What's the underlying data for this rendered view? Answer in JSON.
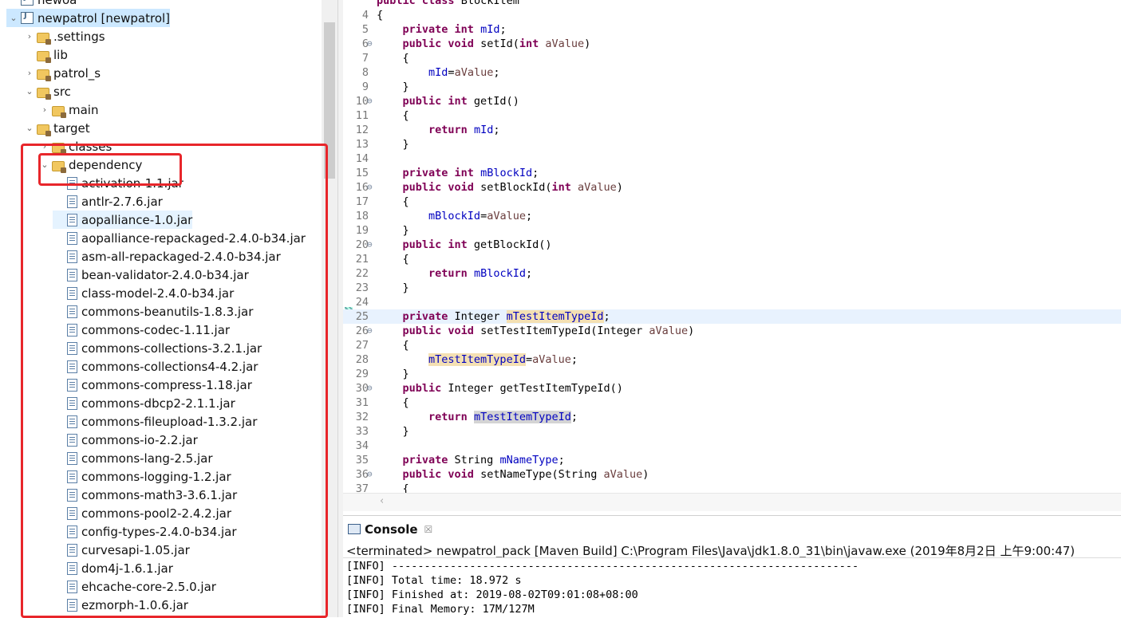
{
  "tree": {
    "rows": [
      {
        "label": "newoa",
        "level": 1,
        "icon": "project-icon",
        "chev": ""
      },
      {
        "label": "newpatrol [newpatrol]",
        "level": 1,
        "icon": "project-icon",
        "chev": "⌄",
        "selected": true
      },
      {
        "label": ".settings",
        "level": 2,
        "icon": "folder-icon",
        "chev": "›"
      },
      {
        "label": "lib",
        "level": 2,
        "icon": "folder-icon",
        "chev": ""
      },
      {
        "label": "patrol_s",
        "level": 2,
        "icon": "folder-icon",
        "chev": "›"
      },
      {
        "label": "src",
        "level": 2,
        "icon": "folder-icon",
        "chev": "⌄"
      },
      {
        "label": "main",
        "level": 3,
        "icon": "folder-icon",
        "chev": "›"
      },
      {
        "label": "target",
        "level": 2,
        "icon": "folder-icon",
        "chev": "⌄"
      },
      {
        "label": "classes",
        "level": 3,
        "icon": "folder-icon",
        "chev": "›"
      },
      {
        "label": "dependency",
        "level": 3,
        "icon": "folder-icon",
        "chev": "⌄"
      },
      {
        "label": "activation-1.1.jar",
        "level": 4,
        "icon": "jar-icon",
        "chev": ""
      },
      {
        "label": "antlr-2.7.6.jar",
        "level": 4,
        "icon": "jar-icon",
        "chev": ""
      },
      {
        "label": "aopalliance-1.0.jar",
        "level": 4,
        "icon": "jar-icon",
        "chev": "",
        "hl": true
      },
      {
        "label": "aopalliance-repackaged-2.4.0-b34.jar",
        "level": 4,
        "icon": "jar-icon",
        "chev": ""
      },
      {
        "label": "asm-all-repackaged-2.4.0-b34.jar",
        "level": 4,
        "icon": "jar-icon",
        "chev": ""
      },
      {
        "label": "bean-validator-2.4.0-b34.jar",
        "level": 4,
        "icon": "jar-icon",
        "chev": ""
      },
      {
        "label": "class-model-2.4.0-b34.jar",
        "level": 4,
        "icon": "jar-icon",
        "chev": ""
      },
      {
        "label": "commons-beanutils-1.8.3.jar",
        "level": 4,
        "icon": "jar-icon",
        "chev": ""
      },
      {
        "label": "commons-codec-1.11.jar",
        "level": 4,
        "icon": "jar-icon",
        "chev": ""
      },
      {
        "label": "commons-collections-3.2.1.jar",
        "level": 4,
        "icon": "jar-icon",
        "chev": ""
      },
      {
        "label": "commons-collections4-4.2.jar",
        "level": 4,
        "icon": "jar-icon",
        "chev": ""
      },
      {
        "label": "commons-compress-1.18.jar",
        "level": 4,
        "icon": "jar-icon",
        "chev": ""
      },
      {
        "label": "commons-dbcp2-2.1.1.jar",
        "level": 4,
        "icon": "jar-icon",
        "chev": ""
      },
      {
        "label": "commons-fileupload-1.3.2.jar",
        "level": 4,
        "icon": "jar-icon",
        "chev": ""
      },
      {
        "label": "commons-io-2.2.jar",
        "level": 4,
        "icon": "jar-icon",
        "chev": ""
      },
      {
        "label": "commons-lang-2.5.jar",
        "level": 4,
        "icon": "jar-icon",
        "chev": ""
      },
      {
        "label": "commons-logging-1.2.jar",
        "level": 4,
        "icon": "jar-icon",
        "chev": ""
      },
      {
        "label": "commons-math3-3.6.1.jar",
        "level": 4,
        "icon": "jar-icon",
        "chev": ""
      },
      {
        "label": "commons-pool2-2.4.2.jar",
        "level": 4,
        "icon": "jar-icon",
        "chev": ""
      },
      {
        "label": "config-types-2.4.0-b34.jar",
        "level": 4,
        "icon": "jar-icon",
        "chev": ""
      },
      {
        "label": "curvesapi-1.05.jar",
        "level": 4,
        "icon": "jar-icon",
        "chev": ""
      },
      {
        "label": "dom4j-1.6.1.jar",
        "level": 4,
        "icon": "jar-icon",
        "chev": ""
      },
      {
        "label": "ehcache-core-2.5.0.jar",
        "level": 4,
        "icon": "jar-icon",
        "chev": ""
      },
      {
        "label": "ezmorph-1.0.6.jar",
        "level": 4,
        "icon": "jar-icon",
        "chev": ""
      }
    ]
  },
  "editor": {
    "lines": [
      {
        "n": "",
        "fold": "",
        "segs": [
          [
            "kw",
            "public "
          ],
          [
            "kw",
            "class "
          ],
          [
            "",
            "BlockItem"
          ]
        ]
      },
      {
        "n": "4",
        "fold": "",
        "segs": [
          [
            "",
            "{"
          ]
        ]
      },
      {
        "n": "5",
        "fold": "",
        "segs": [
          [
            "",
            "    "
          ],
          [
            "kw",
            "private int "
          ],
          [
            "fld",
            "mId"
          ],
          [
            "",
            ";"
          ]
        ]
      },
      {
        "n": "6",
        "fold": "⊖",
        "segs": [
          [
            "",
            "    "
          ],
          [
            "kw",
            "public void "
          ],
          [
            "",
            "setId("
          ],
          [
            "kw",
            "int "
          ],
          [
            "prm",
            "aValue"
          ],
          [
            "",
            ")"
          ]
        ]
      },
      {
        "n": "7",
        "fold": "",
        "segs": [
          [
            "",
            "    {"
          ]
        ]
      },
      {
        "n": "8",
        "fold": "",
        "segs": [
          [
            "",
            "        "
          ],
          [
            "fld",
            "mId"
          ],
          [
            "",
            "="
          ],
          [
            "prm",
            "aValue"
          ],
          [
            "",
            ";"
          ]
        ]
      },
      {
        "n": "9",
        "fold": "",
        "segs": [
          [
            "",
            "    }"
          ]
        ]
      },
      {
        "n": "10",
        "fold": "⊖",
        "segs": [
          [
            "",
            "    "
          ],
          [
            "kw",
            "public int "
          ],
          [
            "",
            "getId()"
          ]
        ]
      },
      {
        "n": "11",
        "fold": "",
        "segs": [
          [
            "",
            "    {"
          ]
        ]
      },
      {
        "n": "12",
        "fold": "",
        "segs": [
          [
            "",
            "        "
          ],
          [
            "kw",
            "return "
          ],
          [
            "fld",
            "mId"
          ],
          [
            "",
            ";"
          ]
        ]
      },
      {
        "n": "13",
        "fold": "",
        "segs": [
          [
            "",
            "    }"
          ]
        ]
      },
      {
        "n": "14",
        "fold": "",
        "segs": []
      },
      {
        "n": "15",
        "fold": "",
        "segs": [
          [
            "",
            "    "
          ],
          [
            "kw",
            "private int "
          ],
          [
            "fld",
            "mBlockId"
          ],
          [
            "",
            ";"
          ]
        ]
      },
      {
        "n": "16",
        "fold": "⊖",
        "segs": [
          [
            "",
            "    "
          ],
          [
            "kw",
            "public void "
          ],
          [
            "",
            "setBlockId("
          ],
          [
            "kw",
            "int "
          ],
          [
            "prm",
            "aValue"
          ],
          [
            "",
            ")"
          ]
        ]
      },
      {
        "n": "17",
        "fold": "",
        "segs": [
          [
            "",
            "    {"
          ]
        ]
      },
      {
        "n": "18",
        "fold": "",
        "segs": [
          [
            "",
            "        "
          ],
          [
            "fld",
            "mBlockId"
          ],
          [
            "",
            "="
          ],
          [
            "prm",
            "aValue"
          ],
          [
            "",
            ";"
          ]
        ]
      },
      {
        "n": "19",
        "fold": "",
        "segs": [
          [
            "",
            "    }"
          ]
        ]
      },
      {
        "n": "20",
        "fold": "⊖",
        "segs": [
          [
            "",
            "    "
          ],
          [
            "kw",
            "public int "
          ],
          [
            "",
            "getBlockId()"
          ]
        ]
      },
      {
        "n": "21",
        "fold": "",
        "segs": [
          [
            "",
            "    {"
          ]
        ]
      },
      {
        "n": "22",
        "fold": "",
        "segs": [
          [
            "",
            "        "
          ],
          [
            "kw",
            "return "
          ],
          [
            "fld",
            "mBlockId"
          ],
          [
            "",
            ";"
          ]
        ]
      },
      {
        "n": "23",
        "fold": "",
        "segs": [
          [
            "",
            "    }"
          ]
        ]
      },
      {
        "n": "24",
        "fold": "",
        "segs": []
      },
      {
        "n": "25",
        "fold": "",
        "current": true,
        "segs": [
          [
            "",
            "    "
          ],
          [
            "kw",
            "private "
          ],
          [
            "",
            "Integer "
          ],
          [
            "fld occ",
            "mTestItemTypeId"
          ],
          [
            "",
            ";"
          ]
        ]
      },
      {
        "n": "26",
        "fold": "⊖",
        "segs": [
          [
            "",
            "    "
          ],
          [
            "kw",
            "public void "
          ],
          [
            "",
            "setTestItemTypeId(Integer "
          ],
          [
            "prm",
            "aValue"
          ],
          [
            "",
            ")"
          ]
        ]
      },
      {
        "n": "27",
        "fold": "",
        "segs": [
          [
            "",
            "    {"
          ]
        ]
      },
      {
        "n": "28",
        "fold": "",
        "segs": [
          [
            "",
            "        "
          ],
          [
            "fld occ",
            "mTestItemTypeId"
          ],
          [
            "",
            "="
          ],
          [
            "prm",
            "aValue"
          ],
          [
            "",
            ";"
          ]
        ]
      },
      {
        "n": "29",
        "fold": "",
        "segs": [
          [
            "",
            "    }"
          ]
        ]
      },
      {
        "n": "30",
        "fold": "⊖",
        "segs": [
          [
            "",
            "    "
          ],
          [
            "kw",
            "public "
          ],
          [
            "",
            "Integer getTestItemTypeId()"
          ]
        ]
      },
      {
        "n": "31",
        "fold": "",
        "segs": [
          [
            "",
            "    {"
          ]
        ]
      },
      {
        "n": "32",
        "fold": "",
        "segs": [
          [
            "",
            "        "
          ],
          [
            "kw",
            "return "
          ],
          [
            "fld occ2",
            "mTestItemTypeId"
          ],
          [
            "",
            ";"
          ]
        ]
      },
      {
        "n": "33",
        "fold": "",
        "segs": [
          [
            "",
            "    }"
          ]
        ]
      },
      {
        "n": "34",
        "fold": "",
        "segs": []
      },
      {
        "n": "35",
        "fold": "",
        "segs": [
          [
            "",
            "    "
          ],
          [
            "kw",
            "private "
          ],
          [
            "",
            "String "
          ],
          [
            "fld",
            "mNameType"
          ],
          [
            "",
            ";"
          ]
        ]
      },
      {
        "n": "36",
        "fold": "⊖",
        "segs": [
          [
            "",
            "    "
          ],
          [
            "kw",
            "public void "
          ],
          [
            "",
            "setNameType(String "
          ],
          [
            "prm",
            "aValue"
          ],
          [
            "",
            ")"
          ]
        ]
      },
      {
        "n": "37",
        "fold": "",
        "segs": [
          [
            "",
            "    {"
          ]
        ]
      }
    ]
  },
  "console": {
    "tab_label": "Console",
    "close_glyph": "☒",
    "status": "<terminated> newpatrol_pack [Maven Build] C:\\Program Files\\Java\\jdk1.8.0_31\\bin\\javaw.exe (2019年8月2日 上午9:00:47)",
    "lines": [
      "[INFO] ------------------------------------------------------------------------",
      "[INFO] Total time: 18.972 s",
      "[INFO] Finished at: 2019-08-02T09:01:08+08:00",
      "[INFO] Final Memory: 17M/127M"
    ]
  },
  "colors": {
    "highlight_box": "#e8262b",
    "selection": "#cce8ff",
    "keyword": "#7f0055",
    "field": "#0000c0"
  }
}
